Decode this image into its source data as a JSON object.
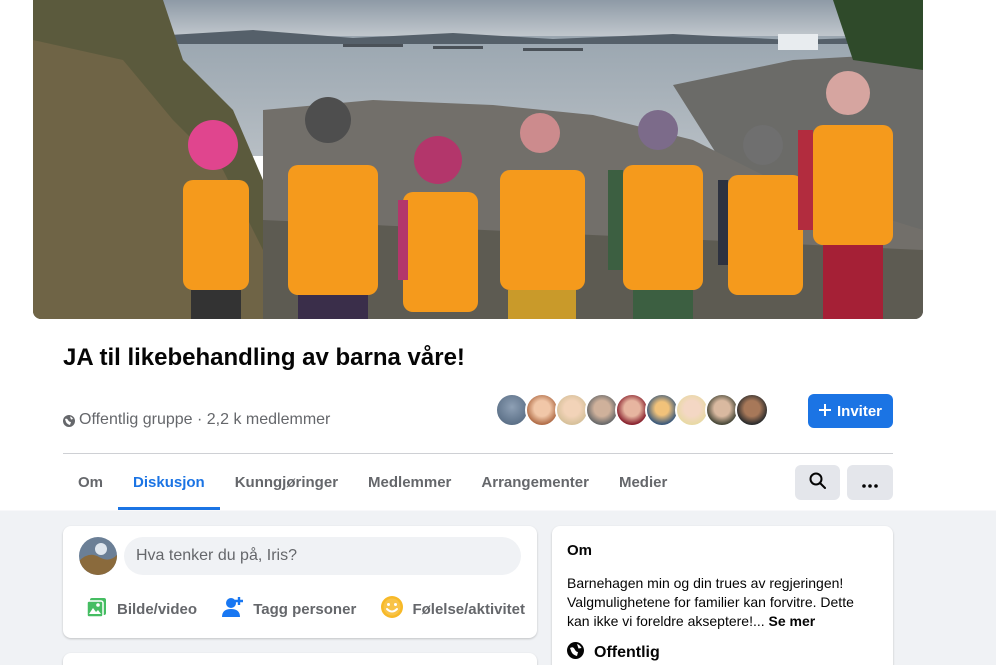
{
  "group": {
    "title": "JA til likebehandling av barna våre!",
    "meta": "Offentlig gruppe · 2,2 k medlemmer",
    "invite_label": "Inviter"
  },
  "tabs": [
    {
      "label": "Om"
    },
    {
      "label": "Diskusjon"
    },
    {
      "label": "Kunngjøringer"
    },
    {
      "label": "Medlemmer"
    },
    {
      "label": "Arrangementer"
    },
    {
      "label": "Medier"
    }
  ],
  "active_tab": "Diskusjon",
  "composer": {
    "placeholder": "Hva tenker du på, Iris?",
    "actions": [
      {
        "label": "Bilde/video",
        "icon": "photo-video-icon"
      },
      {
        "label": "Tagg personer",
        "icon": "tag-people-icon"
      },
      {
        "label": "Følelse/aktivitet",
        "icon": "feeling-icon"
      }
    ]
  },
  "about": {
    "title": "Om",
    "text": "Barnehagen min og din trues av regjeringen! Valgmulighetene for familier kan forvitre. Dette kan ikke vi foreldre akseptere!...",
    "see_more": "Se mer",
    "privacy": "Offentlig"
  },
  "colors": {
    "accent": "#1b74e4",
    "vest": "#f59a1c",
    "secondary_text": "#65676b"
  }
}
